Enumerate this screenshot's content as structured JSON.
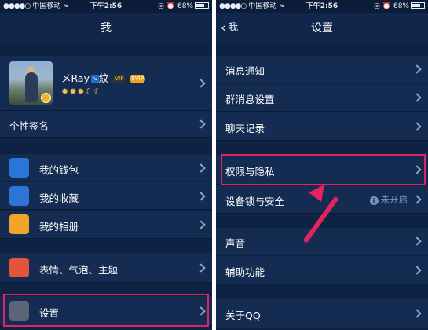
{
  "left_screen": {
    "status": {
      "carrier": "中国移动",
      "time": "下午2:56",
      "battery": "68%"
    },
    "title": "我",
    "profile": {
      "nickname": "メRay",
      "nickname_suffix": "紋",
      "vip_a": "↘",
      "vip_b": "VIP",
      "vip_c": "SVIP",
      "levels": "✹✹✹☾☾"
    },
    "signature_label": "个性签名",
    "menu": [
      {
        "label": "我的钱包",
        "icon": "wallet-icon",
        "color": "#2d74d8"
      },
      {
        "label": "我的收藏",
        "icon": "star-box-icon",
        "color": "#2d74d8"
      },
      {
        "label": "我的相册",
        "icon": "photo-icon",
        "color": "#f0a52a"
      }
    ],
    "theme_label": "表情、气泡、主题",
    "theme_icon_color": "#e2553a",
    "settings_label": "设置"
  },
  "right_screen": {
    "status": {
      "carrier": "中国移动",
      "time": "下午2:56",
      "battery": "68%"
    },
    "back_label": "我",
    "title": "设置",
    "group1": [
      "消息通知",
      "群消息设置",
      "聊天记录"
    ],
    "privacy_label": "权限与隐私",
    "device_lock_label": "设备锁与安全",
    "device_lock_status": "未开启",
    "group3": [
      "声音",
      "辅助功能"
    ],
    "about_label": "关于QQ"
  },
  "colors": {
    "highlight": "#e0245e",
    "background": "#0e2243",
    "row": "#142c52"
  }
}
